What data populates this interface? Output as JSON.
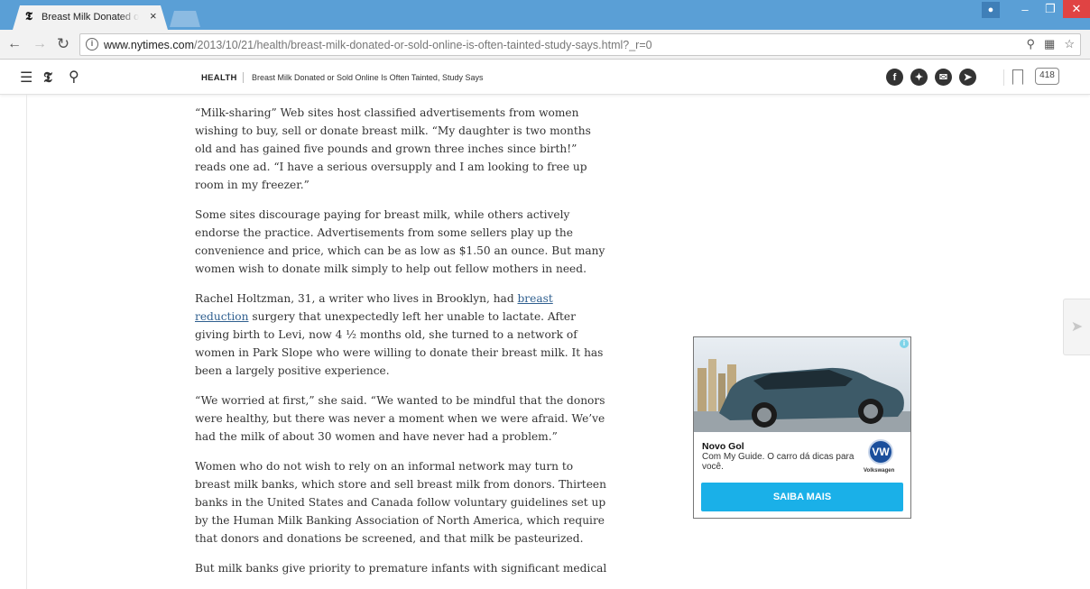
{
  "browser": {
    "tab_title": "Breast Milk Donated or S",
    "tab_close": "×",
    "url_host": "www.nytimes.com",
    "url_path": "/2013/10/21/health/breast-milk-donated-or-sold-online-is-often-tainted-study-says.html?_r=0",
    "omnibox_info": "i"
  },
  "header": {
    "section": "HEALTH",
    "headline": "Breast Milk Donated or Sold Online Is Often Tainted, Study Says",
    "comment_count": "418",
    "share_icons": [
      "facebook-icon",
      "twitter-icon",
      "email-icon",
      "share-icon"
    ]
  },
  "article": {
    "paragraphs": [
      {
        "text": "“Milk-sharing” Web sites host classified advertisements from women wishing to buy, sell or donate breast milk. “My daughter is two months old and has gained five pounds and grown three inches since birth!” reads one ad. “I have a serious oversupply and I am looking to free up room in my freezer.”"
      },
      {
        "text": "Some sites discourage paying for breast milk, while others actively endorse the practice. Advertisements from some sellers play up the convenience and price, which can be as low as $1.50 an ounce. But many women wish to donate milk simply to help out fellow mothers in need."
      },
      {
        "before": "Rachel Holtzman, 31, a writer who lives in Brooklyn, had ",
        "link": "breast reduction",
        "after": " surgery that unexpectedly left her unable to lactate. After giving birth to Levi, now 4 ½ months old, she turned to a network of women in Park Slope who were willing to donate their breast milk. It has been a largely positive experience."
      },
      {
        "text": "“We worried at first,” she said. “We wanted to be mindful that the donors were healthy, but there was never a moment when we were afraid. We’ve had the milk of about 30 women and have never had a problem.”"
      },
      {
        "text": "Women who do not wish to rely on an informal network may turn to breast milk banks, which store and sell breast milk from donors. Thirteen banks in the United States and Canada follow voluntary guidelines set up by the Human Milk Banking Association of North America, which require that donors and donations be screened, and that milk be pasteurized."
      },
      {
        "text": "But milk banks give priority to premature infants with significant medical"
      }
    ]
  },
  "ad": {
    "title": "Novo Gol",
    "description": "Com My Guide. O carro dá dicas para você.",
    "brand": "Volkswagen",
    "brand_mark": "VW",
    "cta": "SAIBA MAIS",
    "adchoices": "i"
  },
  "colors": {
    "tabstrip": "#5a9fd6",
    "ad_cta": "#1ab0e8",
    "link": "#2f5f8f"
  }
}
